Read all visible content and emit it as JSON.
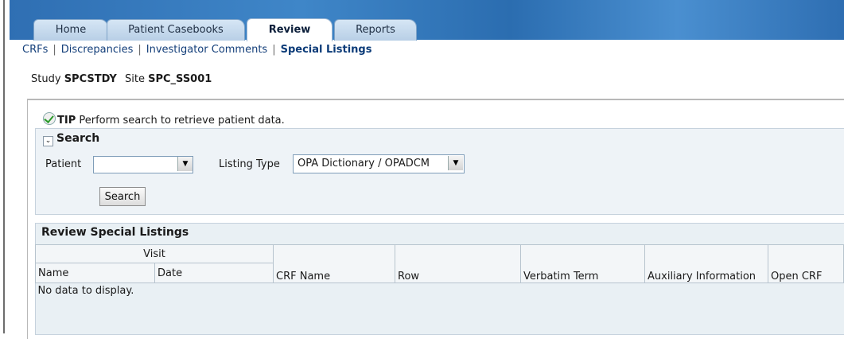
{
  "tabs": [
    {
      "label": "Home",
      "active": false
    },
    {
      "label": "Patient Casebooks",
      "active": false
    },
    {
      "label": "Review",
      "active": true
    },
    {
      "label": "Reports",
      "active": false
    }
  ],
  "subnav": {
    "items": [
      "CRFs",
      "Discrepancies",
      "Investigator Comments",
      "Special Listings"
    ],
    "current": "Special Listings"
  },
  "context": {
    "study_label": "Study",
    "study_value": "SPCSTDY",
    "site_label": "Site",
    "site_value": "SPC_SS001"
  },
  "tip": {
    "icon": "check-circle-icon",
    "label": "TIP",
    "text": "Perform search to retrieve patient data."
  },
  "search": {
    "title": "Search",
    "patient_label": "Patient",
    "patient_value": "",
    "listing_type_label": "Listing Type",
    "listing_type_value": "OPA Dictionary / OPADCM",
    "button_label": "Search"
  },
  "results": {
    "title": "Review Special Listings",
    "group_header": "Visit",
    "columns": [
      "Name",
      "Date",
      "CRF Name",
      "Row",
      "Verbatim Term",
      "Auxiliary Information",
      "Open CRF"
    ],
    "empty_text": "No data to display."
  },
  "colors": {
    "banner": "#3a7fc2",
    "link": "#143f7a",
    "panel_bg": "#eef3f7"
  }
}
